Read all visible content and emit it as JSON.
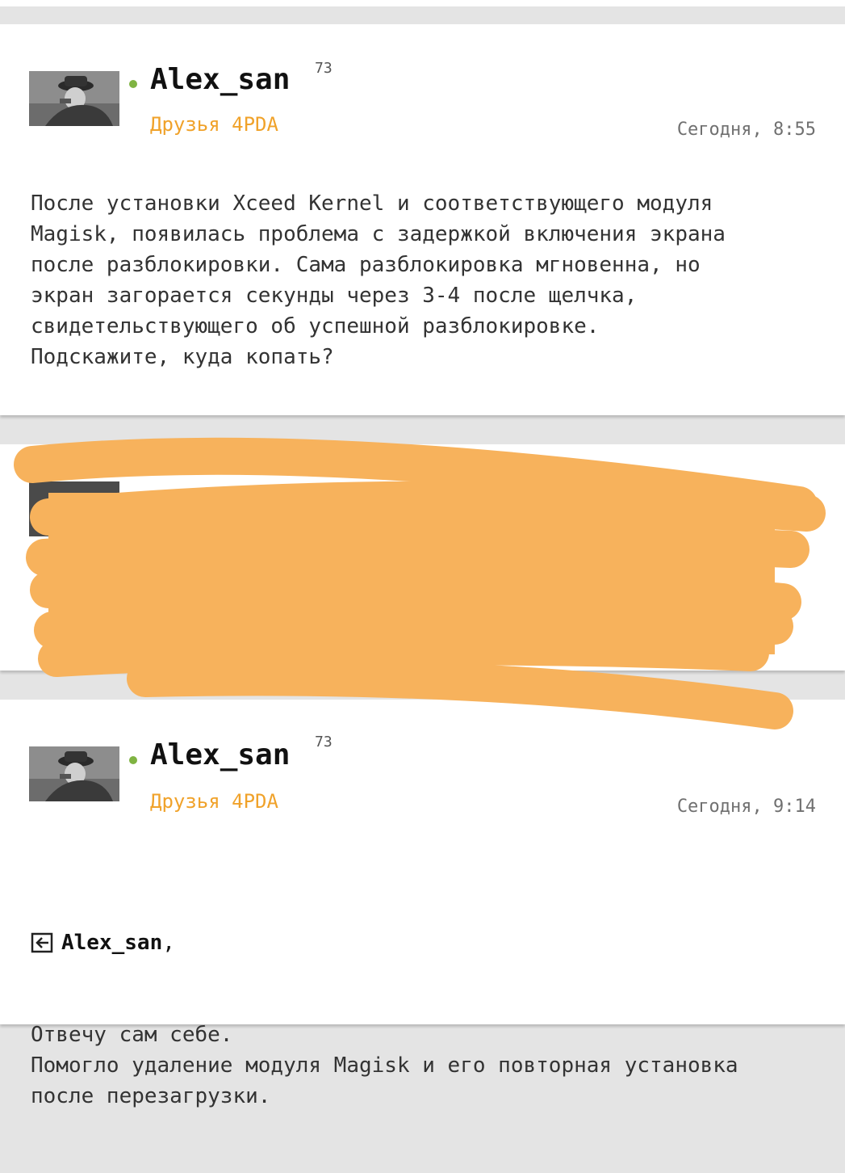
{
  "posts": [
    {
      "author": "Alex_san",
      "reputation": "73",
      "group": "Друзья 4PDA",
      "date": "Сегодня, 8:55",
      "body": "После установки Xceed Kernel и соответствующего модуля\nMagisk, появилась проблема с задержкой включения экрана\nпосле разблокировки. Сама разблокировка мгновенна, но\nэкран загорается секунды через 3-4 после щелчка,\nсвидетельствующего об успешной разблокировке.\nПодскажите, куда копать?"
    },
    {
      "author": "Alex_san",
      "reputation": "73",
      "group": "Друзья 4PDA",
      "date": "Сегодня, 9:14",
      "reply_to": "Alex_san",
      "reply_suffix": ",",
      "body": "Отвечу сам себе.\nПомогло удаление модуля Magisk и его повторная установка\nпосле перезагрузки."
    }
  ],
  "colors": {
    "online": "#7fb342",
    "group": "#f0a22a",
    "scribble": "#f7b25c"
  },
  "icons": {
    "reply": "quote-arrow-icon"
  }
}
